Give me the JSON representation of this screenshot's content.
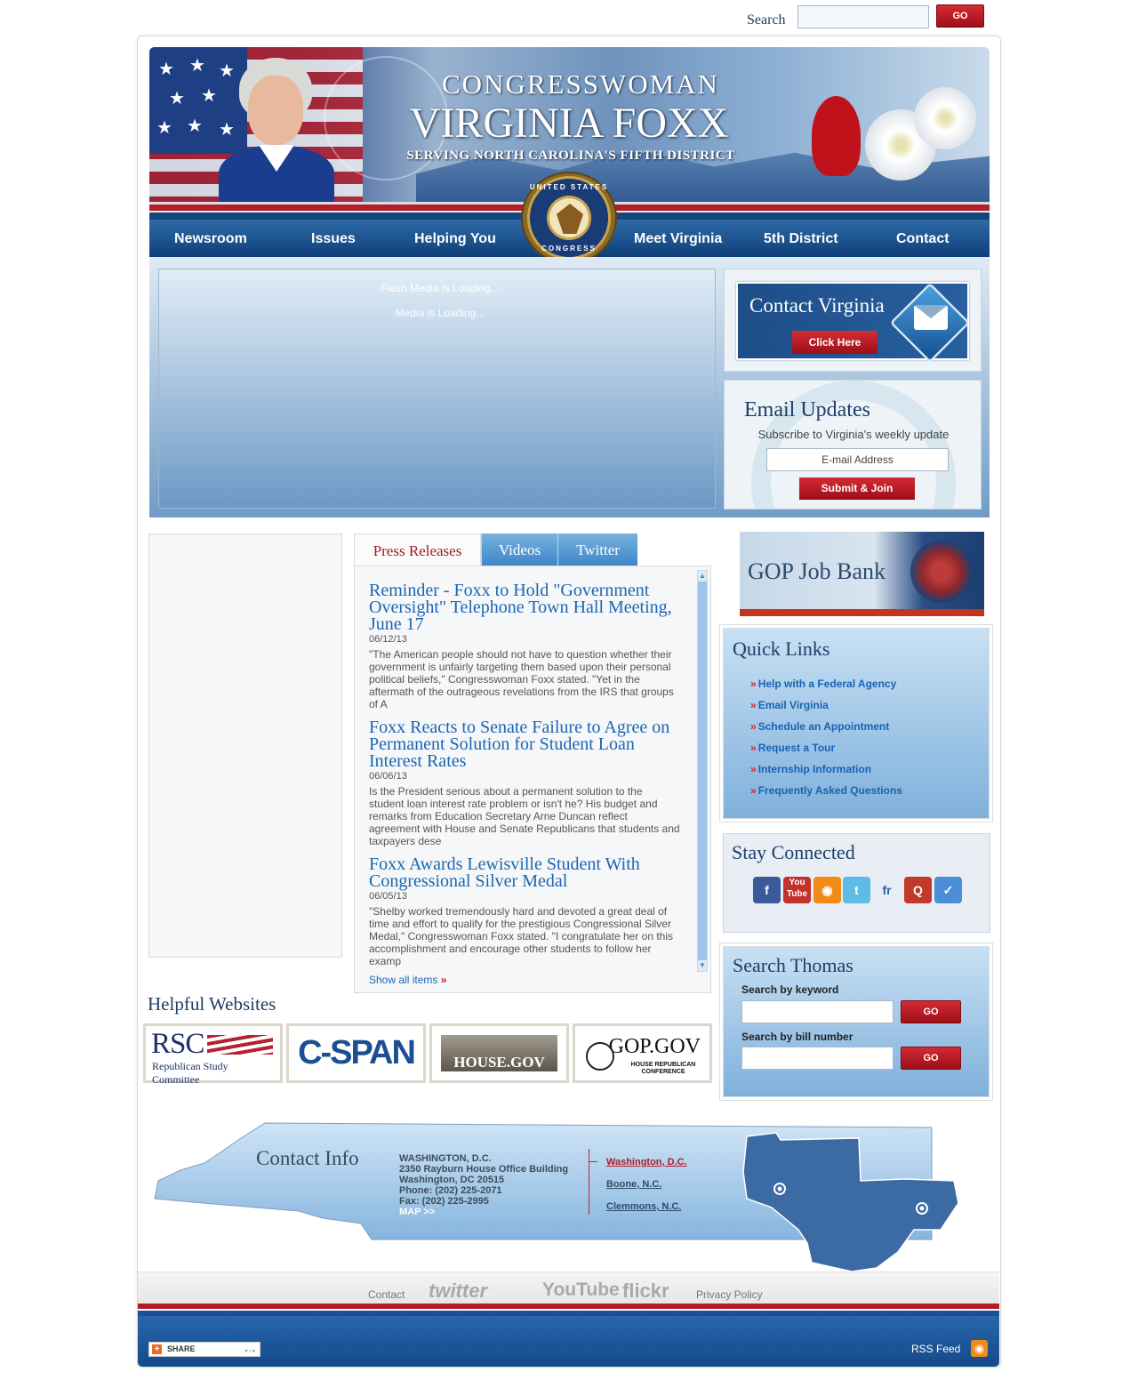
{
  "top_search": {
    "label": "Search",
    "go": "GO"
  },
  "banner": {
    "line1": "CONGRESSWOMAN",
    "line2": "VIRGINIA FOXX",
    "line3": "SERVING NORTH CAROLINA'S FIFTH DISTRICT"
  },
  "seal": {
    "top": "UNITED STATES",
    "bottom": "CONGRESS"
  },
  "nav": {
    "items": [
      "Newsroom",
      "Issues",
      "Helping You",
      "Meet Virginia",
      "5th District",
      "Contact"
    ]
  },
  "flash": {
    "msg1": "Flash Media is Loading...",
    "msg2": "Media is Loading..."
  },
  "contact_box": {
    "title": "Contact Virginia",
    "button": "Click Here"
  },
  "email_updates": {
    "title": "Email Updates",
    "subtitle": "Subscribe to Virginia's weekly update",
    "placeholder": "E-mail Address",
    "button": "Submit & Join"
  },
  "tabs": [
    "Press Releases",
    "Videos",
    "Twitter"
  ],
  "press_releases": [
    {
      "title": "Reminder - Foxx to Hold \"Government Oversight\" Telephone Town Hall Meeting, June 17",
      "date": "06/12/13",
      "summary": "\"The American people should not have to question whether their government is unfairly targeting them based upon their personal political beliefs,\" Congresswoman Foxx stated. \"Yet in the aftermath of the outrageous revelations from the IRS that groups of A"
    },
    {
      "title": "Foxx Reacts to Senate Failure to Agree on Permanent Solution for Student Loan Interest Rates",
      "date": "06/06/13",
      "summary": "Is the President serious about a permanent solution to the student loan interest rate problem or isn't he? His budget and remarks from Education Secretary Arne Duncan reflect agreement with House and Senate Republicans that students and taxpayers dese"
    },
    {
      "title": "Foxx Awards Lewisville Student With Congressional Silver Medal",
      "date": "06/05/13",
      "summary": "\"Shelby worked tremendously hard and devoted a great deal of time and effort to qualify for the prestigious Congressional Silver Medal,\" Congresswoman Foxx stated. \"I congratulate her on this accomplishment and encourage other students to follow her examp"
    }
  ],
  "show_all": "Show all items",
  "gop_job_bank": "GOP Job Bank",
  "quick_links": {
    "title": "Quick Links",
    "items": [
      "Help with a Federal Agency",
      "Email Virginia",
      "Schedule an Appointment",
      "Request a Tour",
      "Internship Information",
      "Frequently Asked Questions"
    ]
  },
  "stay_connected": {
    "title": "Stay Connected",
    "icons": [
      "facebook-icon",
      "youtube-icon",
      "rss-icon",
      "twitter-icon",
      "friendfeed-icon",
      "qik-icon",
      "foursquare-icon"
    ]
  },
  "search_thomas": {
    "title": "Search Thomas",
    "keyword_label": "Search by keyword",
    "bill_label": "Search by bill number",
    "go": "GO"
  },
  "helpful_websites": {
    "title": "Helpful Websites",
    "rsc": "RSC",
    "rsc_sub": "Republican Study Committee",
    "cspan": "C-SPAN",
    "house": "HOUSE.GOV",
    "gop": "GOP.GOV",
    "gop_sub": "HOUSE REPUBLICAN CONFERENCE"
  },
  "contact_info": {
    "title": "Contact Info",
    "address": [
      "WASHINGTON, D.C.",
      "2350 Rayburn House Office Building",
      "Washington, DC 20515",
      "Phone: (202) 225-2071",
      "Fax: (202) 225-2995"
    ],
    "map_link": "MAP >>",
    "offices": [
      "Washington, D.C.",
      "Boone, N.C.",
      "Clemmons, N.C."
    ]
  },
  "footer": {
    "contact": "Contact",
    "twitter": "twitter",
    "youtube": "YouTube",
    "flickr": "flickr",
    "privacy": "Privacy Policy",
    "share": "SHARE",
    "rss": "RSS Feed"
  },
  "colors": {
    "nav_blue": "#0f3f78",
    "accent_red": "#b51e28",
    "link_blue": "#1a66b4"
  }
}
